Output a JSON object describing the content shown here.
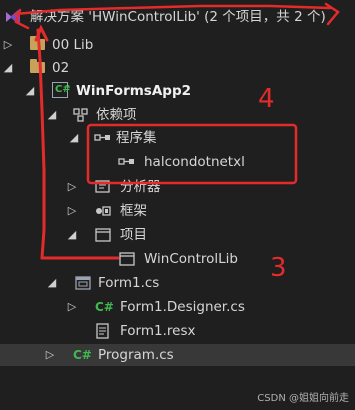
{
  "solution": {
    "label": "解决方案 'HWinControlLib' (2 个项目，共 2 个)"
  },
  "tree": {
    "lib_folder": "00 Lib",
    "folder_02": "02",
    "project": "WinFormsApp2",
    "dependencies": "依赖项",
    "assemblies": "程序集",
    "assembly_item": "halcondotnetxl",
    "analyzers": "分析器",
    "frameworks": "框架",
    "projects": "项目",
    "project_ref": "WinControlLib",
    "form1": "Form1.cs",
    "form1_designer": "Form1.Designer.cs",
    "form1_resx": "Form1.resx",
    "program": "Program.cs"
  },
  "annotations": {
    "four": "4",
    "three": "3"
  },
  "footer": {
    "watermark": "CSDN @姐姐向前走"
  },
  "colors": {
    "annotation_red": "#e32b2b",
    "cs_green": "#3fb950",
    "folder": "#c8a25a",
    "vs_purple": "#a26bd8"
  }
}
